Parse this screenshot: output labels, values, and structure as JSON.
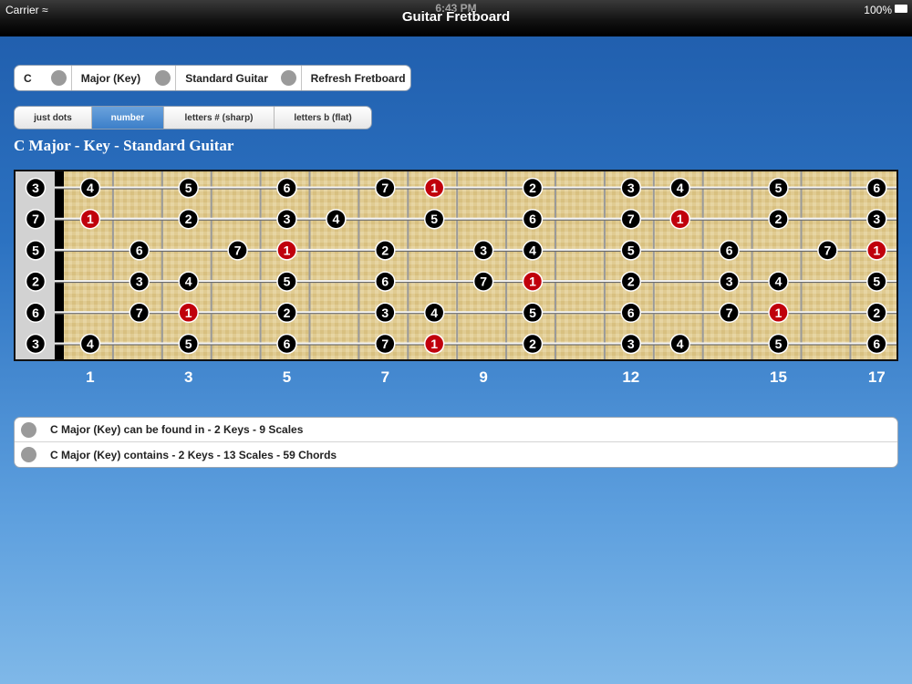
{
  "status_bar": {
    "carrier": "Carrier",
    "time": "6:43 PM",
    "battery": "100%"
  },
  "nav": {
    "title": "Guitar Fretboard"
  },
  "selector": {
    "key": "C",
    "scale": "Major (Key)",
    "tuning": "Standard Guitar",
    "refresh": "Refresh Fretboard"
  },
  "display_modes": {
    "options": [
      "just dots",
      "number",
      "letters # (sharp)",
      "letters b (flat)"
    ],
    "selected": "number"
  },
  "fretboard_title": "C Major - Key - Standard Guitar",
  "fretboard": {
    "frets": 17,
    "root_color": "#c0000c",
    "note_color": "#000000",
    "strings": [
      {
        "open": "3",
        "notes": {
          "1": "4",
          "3": "5",
          "5": "6",
          "7": "7",
          "8": "1",
          "10": "2",
          "12": "3",
          "13": "4",
          "15": "5",
          "17": "6"
        }
      },
      {
        "open": "7",
        "notes": {
          "1": "1",
          "3": "2",
          "5": "3",
          "6": "4",
          "8": "5",
          "10": "6",
          "12": "7",
          "13": "1",
          "15": "2",
          "17": "3"
        }
      },
      {
        "open": "5",
        "notes": {
          "2": "6",
          "4": "7",
          "5": "1",
          "7": "2",
          "9": "3",
          "10": "4",
          "12": "5",
          "14": "6",
          "16": "7",
          "17": "1"
        }
      },
      {
        "open": "2",
        "notes": {
          "2": "3",
          "3": "4",
          "5": "5",
          "7": "6",
          "9": "7",
          "10": "1",
          "12": "2",
          "14": "3",
          "15": "4",
          "17": "5"
        }
      },
      {
        "open": "6",
        "notes": {
          "2": "7",
          "3": "1",
          "5": "2",
          "7": "3",
          "8": "4",
          "10": "5",
          "12": "6",
          "14": "7",
          "15": "1",
          "17": "2"
        }
      },
      {
        "open": "3",
        "notes": {
          "1": "4",
          "3": "5",
          "5": "6",
          "7": "7",
          "8": "1",
          "10": "2",
          "12": "3",
          "13": "4",
          "15": "5",
          "17": "6"
        }
      }
    ],
    "fret_markers": [
      "1",
      "3",
      "5",
      "7",
      "9",
      "12",
      "15",
      "17"
    ]
  },
  "info": [
    {
      "text": "C Major (Key) can be found in - 2 Keys - 9 Scales"
    },
    {
      "text": "C Major (Key) contains - 2 Keys - 13 Scales - 59 Chords"
    }
  ]
}
